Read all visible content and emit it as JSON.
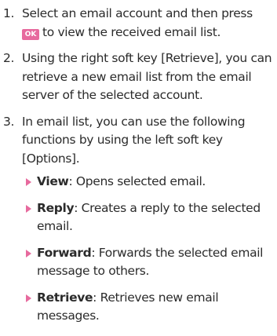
{
  "steps": [
    {
      "num": "1.",
      "text_before": "Select an email account and then press",
      "key_label": "OK",
      "text_after": "to view the received email list."
    },
    {
      "num": "2.",
      "text": "Using the right soft key [Retrieve], you can retrieve a new email list from the email server of the selected account."
    },
    {
      "num": "3.",
      "text": "In email list, you can use the following functions by using the left soft key [Options]."
    }
  ],
  "options": [
    {
      "term": "View",
      "desc": ": Opens selected email."
    },
    {
      "term": "Reply",
      "desc": ": Creates a reply to the selected email."
    },
    {
      "term": "Forward",
      "desc": ": Forwards the selected email message to others."
    },
    {
      "term": "Retrieve",
      "desc": ": Retrieves new email messages."
    }
  ],
  "colors": {
    "accent": "#e76a9e",
    "text": "#2b2b2b"
  },
  "icons": {
    "ok_key": "ok-key-icon",
    "bullet": "triangle-bullet-icon"
  }
}
